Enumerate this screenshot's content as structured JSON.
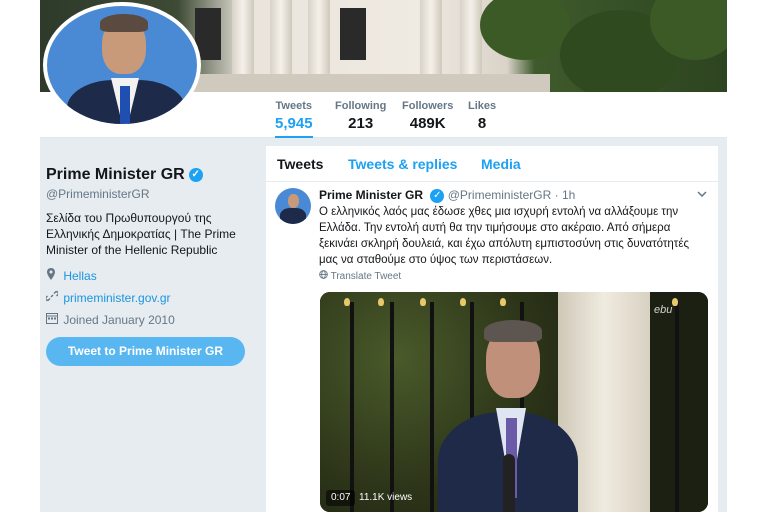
{
  "stats": [
    {
      "label": "Tweets",
      "value": "5,945"
    },
    {
      "label": "Following",
      "value": "213"
    },
    {
      "label": "Followers",
      "value": "489K"
    },
    {
      "label": "Likes",
      "value": "8"
    }
  ],
  "profile": {
    "name": "Prime Minister GR",
    "verified_mark": "✓",
    "handle": "@PrimeministerGR",
    "bio": "Σελίδα του Πρωθυπουργού της Ελληνικής Δημοκρατίας | The Prime Minister of the Hellenic Republic",
    "location": "Hellas",
    "website": "primeminister.gov.gr",
    "joined": "Joined January 2010",
    "tweet_to_label": "Tweet to Prime Minister GR"
  },
  "tabs": [
    {
      "label": "Tweets"
    },
    {
      "label": "Tweets & replies"
    },
    {
      "label": "Media"
    }
  ],
  "tweet": {
    "author": "Prime Minister GR",
    "handle": "@PrimeministerGR",
    "separator": "·",
    "age": "1h",
    "text": "Ο ελληνικός λαός μας έδωσε χθες μια ισχυρή εντολή να αλλάξουμε την Ελλάδα. Την εντολή αυτή θα την τιμήσουμε στο ακέραιο. Από σήμερα ξεκινάει σκληρή δουλειά, και έχω απόλυτη εμπιστοσύνη στις δυνατότητές μας να σταθούμε στο ύψος των περιστάσεων.",
    "translate_label": "Translate Tweet",
    "video": {
      "time": "0:07",
      "views": "11.1K views",
      "logo": "ebu"
    }
  },
  "icons": {
    "verified": "verified-badge-icon",
    "location": "location-pin-icon",
    "link": "link-icon",
    "calendar": "calendar-icon",
    "globe": "globe-icon",
    "caret": "chevron-down-icon"
  },
  "colors": {
    "accent": "#1da1f2",
    "tweet_to_button": "#58b7f0",
    "background": "#e6ecf0",
    "text": "#14171a",
    "muted": "#657786"
  }
}
